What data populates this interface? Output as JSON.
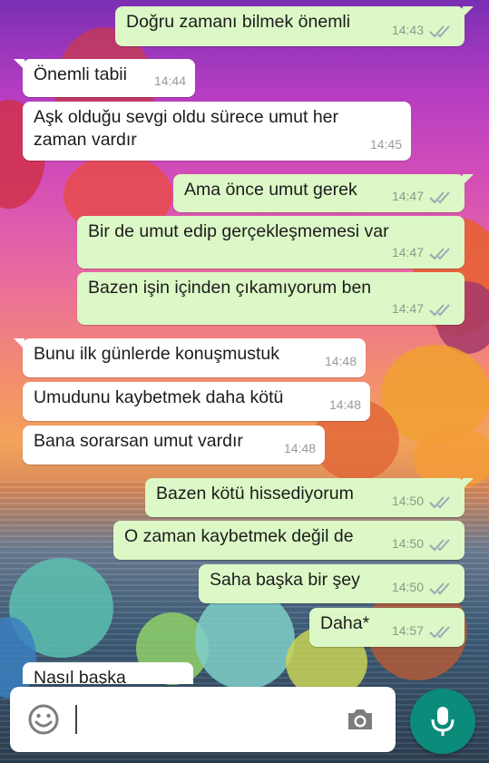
{
  "messages": [
    {
      "dir": "out",
      "text": "Doğru zamanı bilmek önemli",
      "time": "14:43",
      "read": true
    },
    {
      "dir": "in",
      "text": "Önemli tabii",
      "time": "14:44"
    },
    {
      "dir": "in",
      "text": "Aşk olduğu sevgi oldu sürece umut her zaman vardır",
      "time": "14:45"
    },
    {
      "dir": "out",
      "text": "Ama önce umut gerek",
      "time": "14:47",
      "read": true
    },
    {
      "dir": "out",
      "text": "Bir de umut edip gerçekleşmemesi var",
      "time": "14:47",
      "read": true
    },
    {
      "dir": "out",
      "text": "Bazen işin içinden çıkamıyorum ben",
      "time": "14:47",
      "read": true
    },
    {
      "dir": "in",
      "text": "Bunu ilk günlerde konuşmustuk",
      "time": "14:48"
    },
    {
      "dir": "in",
      "text": "Umudunu kaybetmek daha kötü",
      "time": "14:48"
    },
    {
      "dir": "in",
      "text": "Bana sorarsan umut vardır",
      "time": "14:48"
    },
    {
      "dir": "out",
      "text": "Bazen kötü hissediyorum",
      "time": "14:50",
      "read": true
    },
    {
      "dir": "out",
      "text": "O zaman kaybetmek değil de",
      "time": "14:50",
      "read": true
    },
    {
      "dir": "out",
      "text": "Saha başka bir şey",
      "time": "14:50",
      "read": true
    },
    {
      "dir": "out",
      "text": "Daha*",
      "time": "14:57",
      "read": true
    }
  ],
  "partial_message": "Nasıl başka",
  "input": {
    "placeholder": ""
  },
  "icons": {
    "emoji": "emoji-icon",
    "camera": "camera-icon",
    "mic": "microphone-icon",
    "read": "double-check-icon"
  },
  "colors": {
    "outgoing": "#dcf8c6",
    "incoming": "#ffffff",
    "accent": "#0b8c7a"
  }
}
